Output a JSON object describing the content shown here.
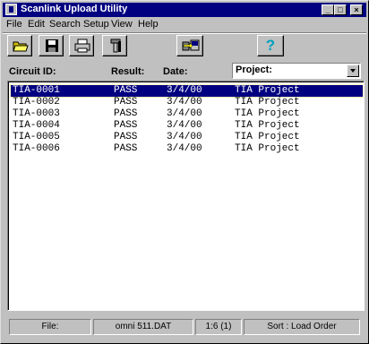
{
  "window": {
    "title": "Scanlink Upload Utility"
  },
  "titlebar_buttons": [
    "_",
    "□",
    "×"
  ],
  "menu": [
    "File",
    "Edit",
    "Search",
    "Setup",
    "View",
    "Help"
  ],
  "toolbar": [
    {
      "name": "open-folder-icon"
    },
    {
      "name": "save-disk-icon"
    },
    {
      "name": "printer-icon"
    },
    {
      "name": "setup-tool-icon"
    },
    {
      "name": "upload-icon"
    },
    {
      "name": "help-icon",
      "glyph": "?"
    }
  ],
  "columns": {
    "circuit": "Circuit ID:",
    "result": "Result:",
    "date": "Date:"
  },
  "project_filter": {
    "value": "Project:"
  },
  "rows": [
    {
      "circuit": "TIA-0001",
      "result": "PASS",
      "date": "3/4/00",
      "project": "TIA Project"
    },
    {
      "circuit": "TIA-0002",
      "result": "PASS",
      "date": "3/4/00",
      "project": "TIA Project"
    },
    {
      "circuit": "TIA-0003",
      "result": "PASS",
      "date": "3/4/00",
      "project": "TIA Project"
    },
    {
      "circuit": "TIA-0004",
      "result": "PASS",
      "date": "3/4/00",
      "project": "TIA Project"
    },
    {
      "circuit": "TIA-0005",
      "result": "PASS",
      "date": "3/4/00",
      "project": "TIA Project"
    },
    {
      "circuit": "TIA-0006",
      "result": "PASS",
      "date": "3/4/00",
      "project": "TIA Project"
    }
  ],
  "selected_row": 0,
  "status": {
    "file_label": "File:",
    "file_name": "omni 511.DAT",
    "position": "1:6 (1)",
    "sort": "Sort : Load Order"
  },
  "colors": {
    "titlebar": "#000080",
    "selection": "#000080",
    "face": "#c0c0c0",
    "help_glyph": "#00a0c0"
  }
}
